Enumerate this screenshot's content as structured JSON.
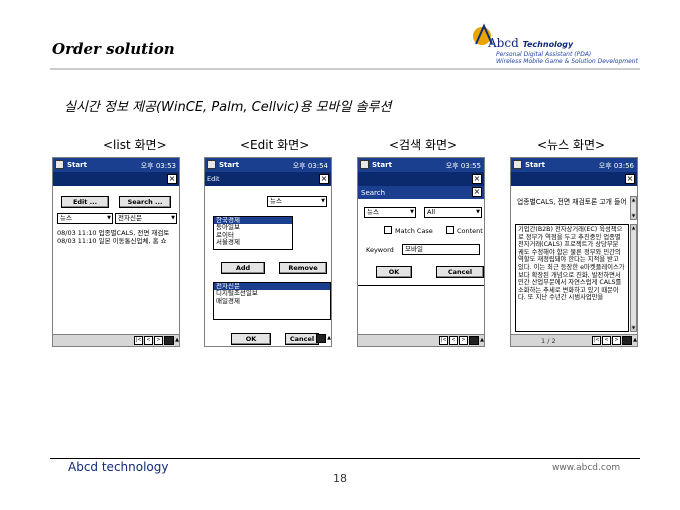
{
  "slide": {
    "title": "Order solution",
    "subtitle": "실시간 정보 제공(WinCE, Palm, Cellvic)용 모바일 솔루션"
  },
  "logo": {
    "name": "Abcd",
    "tag": "Technology",
    "line1": "Personal Digital Assistant (PDA)",
    "line2": "Wireless Mobile Game & Solution Development",
    "accent": "#e8a400",
    "brand": "#102a7a"
  },
  "screens": [
    {
      "label": "<list 화면>",
      "app": "Start",
      "time": "오후 03:53",
      "edit_btn": "Edit ...",
      "search_btn": "Search ...",
      "combo1": "뉴스",
      "combo2": "전자신문",
      "rows": [
        "08/03 11:10 업종별CALS, 전면 재검토",
        "08/03 11:10 일본 이동통신업체, 홈 쇼"
      ]
    },
    {
      "label": "<Edit 화면>",
      "app": "Start",
      "time": "오후 03:54",
      "cmd_label": "Edit",
      "combo": "뉴스",
      "list1": [
        "한국경제",
        "동아일보",
        "로이터",
        "서울경제"
      ],
      "add_btn": "Add",
      "remove_btn": "Remove",
      "list2": [
        "전자신문",
        "디지털조선일보",
        "매일경제"
      ],
      "ok_btn": "OK",
      "cancel_btn": "Cancel"
    },
    {
      "label": "<검색 화면>",
      "app": "Start",
      "time": "오후 03:55",
      "dialog_title": "Search",
      "combo1": "뉴스",
      "combo2": "All",
      "match_case": "Match Case",
      "content": "Content",
      "keyword_label": "Keyword",
      "keyword_value": "모바일",
      "ok_btn": "OK",
      "cancel_btn": "Cancel"
    },
    {
      "label": "<뉴스 화면>",
      "app": "Start",
      "time": "오후 03:56",
      "headline": "업종별CALS, 전면 재검토론 고개 들어",
      "body": "기업간(B2B) 전자상거래(EC) 육성책으로 정부가 역점을 두고 추진중인 업종별 전자거래(CALS) 프로젝트가 상당부분 궤도 수정해야 함은 물론 정부와 민간의 역할도 재정립돼야 한다는 지적을 받고 있다. 이는 최근 등장한 e마켓플레이스가 보다 확장된 개념으로 진화, 발전하면서 민간 산업부문에서 자연스럽게 CALS를 소화하는 추세로 변화하고 있기 때문이다. 또 지난 수년간 시범사업만을",
      "page": "1 / 2"
    }
  ],
  "nav": {
    "first": "|<",
    "prev": "<",
    "next": ">"
  },
  "footer": {
    "company": "Abcd technology",
    "page": "18",
    "url": "www.abcd.com"
  }
}
